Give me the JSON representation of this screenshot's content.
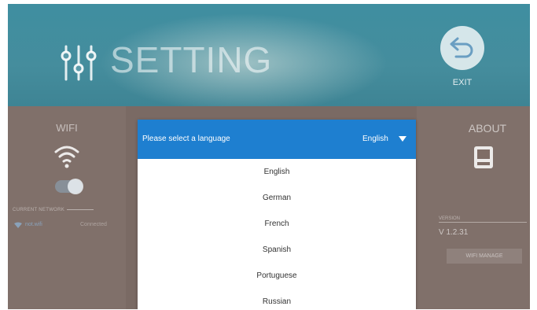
{
  "header": {
    "title": "SETTING",
    "exit_label": "EXIT"
  },
  "wifi_panel": {
    "title": "WIFI",
    "current_network_label": "CURRENT NETWORK",
    "network_name": "not.wifi",
    "network_status": "Connected",
    "toggle_on": true
  },
  "about_panel": {
    "title": "ABOUT",
    "version_label": "VERSION",
    "version_value": "V 1.2.31",
    "wifi_manage_label": "WIFI MANAGE"
  },
  "language_dialog": {
    "prompt": "Please select a language",
    "selected": "English",
    "options": [
      {
        "label": "English"
      },
      {
        "label": "German"
      },
      {
        "label": "French"
      },
      {
        "label": "Spanish"
      },
      {
        "label": "Portuguese"
      },
      {
        "label": "Russian"
      }
    ]
  },
  "colors": {
    "dialog_header": "#1e7fd0",
    "header_band": "#3f8ea0",
    "overlay_panels": "#7b6a63"
  }
}
